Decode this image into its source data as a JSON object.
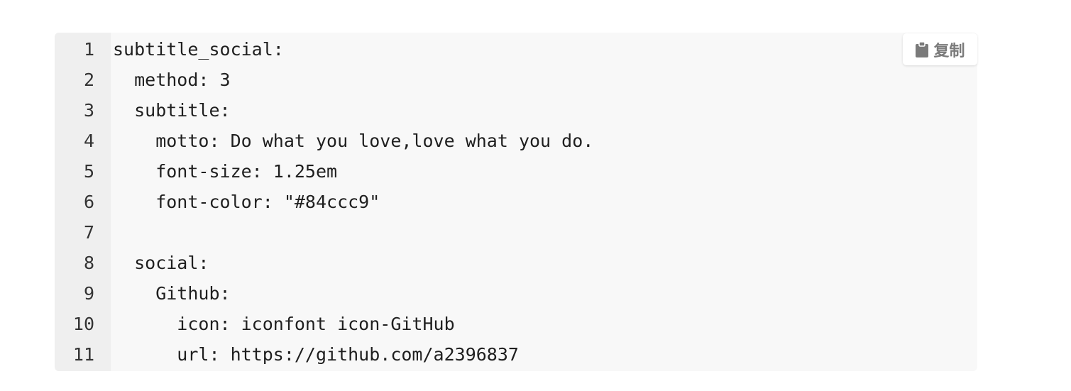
{
  "code_block": {
    "language": "yaml",
    "copy_label": "复制",
    "copy_icon": "clipboard-icon",
    "line_numbers": [
      "1",
      "2",
      "3",
      "4",
      "5",
      "6",
      "7",
      "8",
      "9",
      "10",
      "11"
    ],
    "lines": [
      "subtitle_social:",
      "  method: 3",
      "  subtitle:",
      "    motto: Do what you love,love what you do.",
      "    font-size: 1.25em",
      "    font-color: \"#84ccc9\"",
      "",
      "  social:",
      "    Github:",
      "      icon: iconfont icon-GitHub",
      "      url: https://github.com/a2396837"
    ]
  },
  "colors": {
    "background": "#f8f8f8",
    "gutter": "#efefef",
    "text": "#1f1f1f",
    "copy_text": "#7a7a7a"
  }
}
